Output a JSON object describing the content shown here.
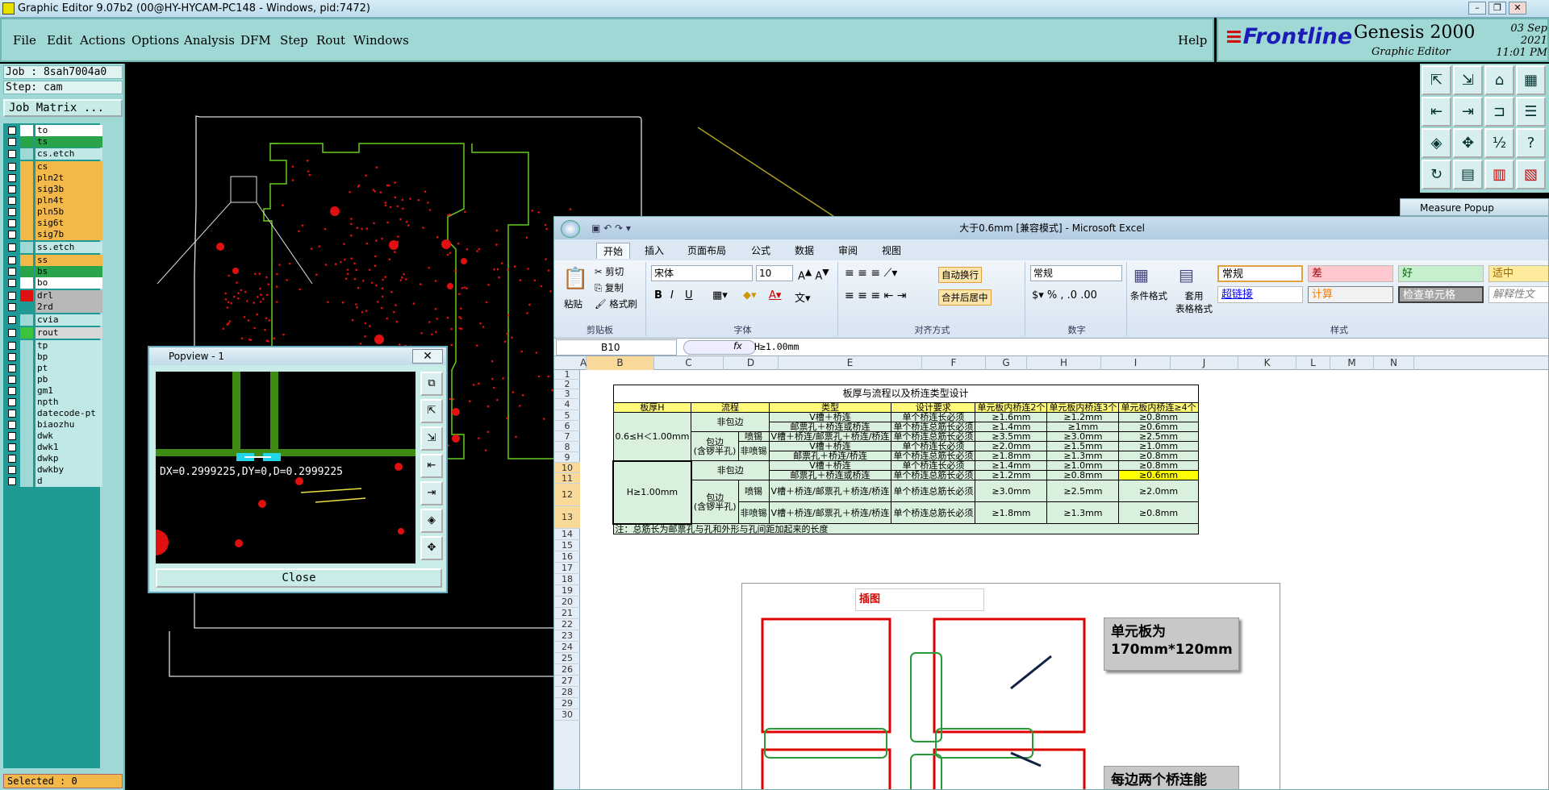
{
  "window": {
    "title": "Graphic Editor 9.07b2 (00@HY-HYCAM-PC148 - Windows, pid:7472)"
  },
  "menu": {
    "items": [
      {
        "label": "File"
      },
      {
        "label": "Edit"
      },
      {
        "label": "Actions"
      },
      {
        "label": "Options"
      },
      {
        "label": "Analysis"
      },
      {
        "label": "DFM"
      },
      {
        "label": "Step"
      },
      {
        "label": "Rout"
      },
      {
        "label": "Windows"
      }
    ],
    "help": "Help"
  },
  "brand": {
    "logo_pre": "Frontline",
    "product": "Genesis 2000",
    "subtitle": "Graphic Editor",
    "date": "03 Sep 2021",
    "time": "11:01 PM"
  },
  "job": {
    "job_line": "Job : 8sah7004a0",
    "step_line": "Step: cam",
    "matrix_button": "Job Matrix ..."
  },
  "layers": [
    {
      "name": "to",
      "color": "#ffffff",
      "bg": "#ffffff"
    },
    {
      "name": "ts",
      "color": "#2aa44a",
      "bg": "#2aa44a"
    },
    {
      "name": "cs.etch",
      "color": "#9fd8d4",
      "bg": "#bfe8e6"
    },
    {
      "name": "cs",
      "color": "#f2b84a",
      "bg": "#f2b84a"
    },
    {
      "name": "pln2t",
      "color": "#f2b84a",
      "bg": "#f2b84a"
    },
    {
      "name": "sig3b",
      "color": "#f2b84a",
      "bg": "#f2b84a"
    },
    {
      "name": "pln4t",
      "color": "#f2b84a",
      "bg": "#f2b84a"
    },
    {
      "name": "pln5b",
      "color": "#f2b84a",
      "bg": "#f2b84a"
    },
    {
      "name": "sig6t",
      "color": "#f2b84a",
      "bg": "#f2b84a"
    },
    {
      "name": "sig7b",
      "color": "#f2b84a",
      "bg": "#f2b84a"
    },
    {
      "name": "ss.etch",
      "color": "#9fd8d4",
      "bg": "#bfe8e6"
    },
    {
      "name": "ss",
      "color": "#f2b84a",
      "bg": "#f2b84a"
    },
    {
      "name": "bs",
      "color": "#2aa44a",
      "bg": "#2aa44a"
    },
    {
      "name": "bo",
      "color": "#ffffff",
      "bg": "#ffffff"
    },
    {
      "name": "drl",
      "color": "#e01010",
      "bg": "#b8b8b8"
    },
    {
      "name": "2rd",
      "color": "#1f9a95",
      "bg": "#b8b8b8"
    },
    {
      "name": "cvia",
      "color": "#9fd8d4",
      "bg": "#bfe8e6"
    },
    {
      "name": "rout",
      "color": "#3cc23c",
      "bg": "#d8d8d8"
    },
    {
      "name": "tp",
      "color": "#9fd8d4",
      "bg": "#bfe8e6"
    },
    {
      "name": "bp",
      "color": "#9fd8d4",
      "bg": "#bfe8e6"
    },
    {
      "name": "pt",
      "color": "#9fd8d4",
      "bg": "#bfe8e6"
    },
    {
      "name": "pb",
      "color": "#9fd8d4",
      "bg": "#bfe8e6"
    },
    {
      "name": "gm1",
      "color": "#9fd8d4",
      "bg": "#bfe8e6"
    },
    {
      "name": "npth",
      "color": "#9fd8d4",
      "bg": "#bfe8e6"
    },
    {
      "name": "datecode-pt",
      "color": "#9fd8d4",
      "bg": "#bfe8e6"
    },
    {
      "name": "biaozhu",
      "color": "#9fd8d4",
      "bg": "#bfe8e6"
    },
    {
      "name": "dwk",
      "color": "#9fd8d4",
      "bg": "#bfe8e6"
    },
    {
      "name": "dwk1",
      "color": "#9fd8d4",
      "bg": "#bfe8e6"
    },
    {
      "name": "dwkp",
      "color": "#9fd8d4",
      "bg": "#bfe8e6"
    },
    {
      "name": "dwkby",
      "color": "#9fd8d4",
      "bg": "#bfe8e6"
    },
    {
      "name": "d",
      "color": "#9fd8d4",
      "bg": "#bfe8e6"
    }
  ],
  "status": {
    "selected": "Selected : 0"
  },
  "popview": {
    "title": "Popview - 1",
    "close": "Close",
    "measure": "DX=0.2999225,DY=0,D=0.2999225"
  },
  "measure_popup": {
    "title": "Measure Popup"
  },
  "excel": {
    "title": "大于0.6mm  [兼容模式] - Microsoft Excel",
    "tabs": [
      "开始",
      "插入",
      "页面布局",
      "公式",
      "数据",
      "审阅",
      "视图"
    ],
    "clipboard": {
      "paste": "粘贴",
      "cut": "剪切",
      "copy": "复制",
      "format_painter": "格式刷",
      "group": "剪贴板"
    },
    "font": {
      "name": "宋体",
      "size": "10",
      "group": "字体"
    },
    "align": {
      "wrap": "自动换行",
      "merge": "合并后居中",
      "group": "对齐方式"
    },
    "number": {
      "format": "常规",
      "group": "数字"
    },
    "styles": {
      "cond": "条件格式",
      "table": "套用\n表格格式",
      "s1": "常规",
      "s2": "差",
      "s3": "好",
      "s4": "适中",
      "s5": "超链接",
      "s6": "计算",
      "s7": "检查单元格",
      "s8": "解释性文",
      "group": "样式"
    },
    "namebox": "B10",
    "formula": "H≥1.00mm",
    "columns": [
      "A",
      "B",
      "C",
      "D",
      "E",
      "F",
      "G",
      "H",
      "I",
      "J",
      "K",
      "L",
      "M",
      "N"
    ],
    "rows": [
      "1",
      "2",
      "3",
      "4",
      "5",
      "6",
      "7",
      "8",
      "9",
      "10",
      "11",
      "12",
      "13",
      "14",
      "15",
      "16",
      "17",
      "18",
      "19",
      "20",
      "21",
      "22",
      "23",
      "24",
      "25",
      "26",
      "27",
      "28",
      "29",
      "30"
    ],
    "sheet": {
      "title": "板厚与流程以及桥连类型设计",
      "headers": [
        "板厚H",
        "流程",
        "类型",
        "设计要求",
        "单元板内桥连2个",
        "单元板内桥连3个",
        "单元板内桥连≥4个"
      ],
      "g1": "0.6≤H＜1.00mm",
      "g2": "H≥1.00mm",
      "nonwrap": "非包边",
      "wrap": "包边\n(含锣半孔)",
      "spray": "喷锡",
      "nospray": "非喷锡",
      "r5": [
        "V槽＋桥连",
        "单个桥连长必须",
        "≥1.6mm",
        "≥1.2mm",
        "≥0.8mm"
      ],
      "r6": [
        "邮票孔＋桥连或桥连",
        "单个桥连总筋长必须",
        "≥1.4mm",
        "≥1mm",
        "≥0.6mm"
      ],
      "r7": [
        "V槽＋桥连/邮票孔＋桥连/桥连",
        "单个桥连总筋长必须",
        "≥3.5mm",
        "≥3.0mm",
        "≥2.5mm"
      ],
      "r8": [
        "V槽＋桥连",
        "单个桥连长必须",
        "≥2.0mm",
        "≥1.5mm",
        "≥1.0mm"
      ],
      "r9": [
        "邮票孔＋桥连/桥连",
        "单个桥连总筋长必须",
        "≥1.8mm",
        "≥1.3mm",
        "≥0.8mm"
      ],
      "r10": [
        "V槽＋桥连",
        "单个桥连长必须",
        "≥1.4mm",
        "≥1.0mm",
        "≥0.8mm"
      ],
      "r11": [
        "邮票孔＋桥连或桥连",
        "单个桥连总筋长必须",
        "≥1.2mm",
        "≥0.8mm",
        "≥0.6mm"
      ],
      "r12": [
        "V槽＋桥连/邮票孔＋桥连/桥连",
        "单个桥连总筋长必须",
        "≥3.0mm",
        "≥2.5mm",
        "≥2.0mm"
      ],
      "r13": [
        "V槽＋桥连/邮票孔＋桥连/桥连",
        "单个桥连总筋长必须",
        "≥1.8mm",
        "≥1.3mm",
        "≥0.8mm"
      ],
      "note": "注：总筋长为邮票孔与孔和外形与孔间距加起来的长度"
    },
    "picture": {
      "caption": "插图",
      "label1": "单元板为\n170mm*120mm",
      "label2": "每边两个桥连能"
    }
  }
}
